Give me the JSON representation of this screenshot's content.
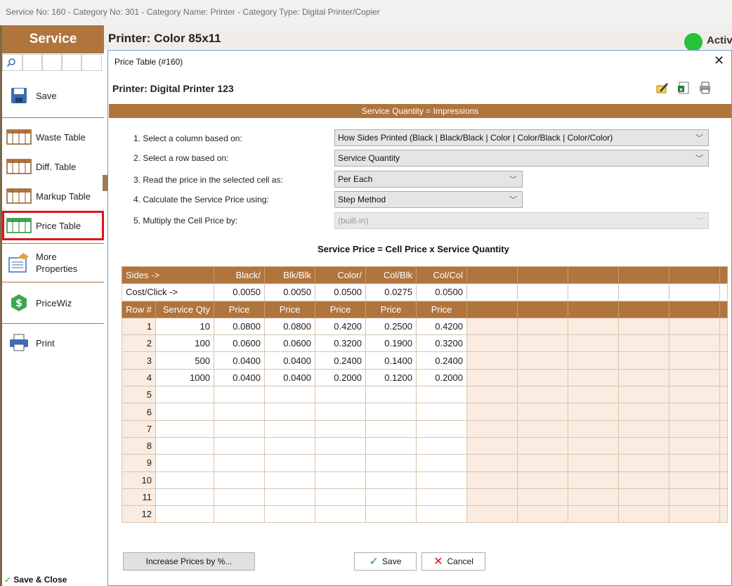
{
  "window": {
    "title": "Service No: 160  -  Category No: 301  -  Category Name: Printer  -  Category Type: Digital Printer/Copier"
  },
  "sidebar": {
    "header": "Service",
    "items": [
      {
        "label": "Save",
        "icon": "save-icon"
      },
      {
        "label": "Waste Table",
        "icon": "table-icon"
      },
      {
        "label": "Diff. Table",
        "icon": "table-icon"
      },
      {
        "label": "Markup Table",
        "icon": "table-icon"
      },
      {
        "label": "Price Table",
        "icon": "table-icon",
        "highlighted": true
      },
      {
        "label": "More Properties",
        "icon": "properties-icon"
      },
      {
        "label": "PriceWiz",
        "icon": "dollar-icon"
      },
      {
        "label": "Print",
        "icon": "printer-icon"
      }
    ],
    "save_close": "Save & Close"
  },
  "main": {
    "title": "Printer: Color 85x11",
    "status": "Activ",
    "status_color": "#26c23a"
  },
  "dialog": {
    "title": "Price Table (#160)",
    "subtitle": "Printer: Digital Printer 123",
    "band": "Service Quantity = Impressions",
    "options": [
      {
        "label": "1. Select a column based on:",
        "value": "How Sides Printed  (Black  |  Black/Black  |  Color  |  Color/Black  |  Color/Color)"
      },
      {
        "label": "2. Select a row based on:",
        "value": "Service Quantity"
      },
      {
        "label": "3. Read the price in the selected cell as:",
        "value": "Per Each"
      },
      {
        "label": "4. Calculate the Service Price using:",
        "value": "Step Method"
      },
      {
        "label": "5. Multiply the Cell Price by:",
        "value": "(built-in)",
        "disabled": true
      }
    ],
    "formula": "Service Price = Cell Price x Service Quantity",
    "table": {
      "sides_label": "Sides ->",
      "sides": [
        "Black/",
        "Blk/Blk",
        "Color/",
        "Col/Blk",
        "Col/Col"
      ],
      "cost_label": "Cost/Click ->",
      "cost": [
        "0.0050",
        "0.0050",
        "0.0500",
        "0.0275",
        "0.0500"
      ],
      "col_row": "Row #",
      "col_qty": "Service Qty",
      "price_label": "Price",
      "rows": [
        {
          "n": "1",
          "qty": "10",
          "p": [
            "0.0800",
            "0.0800",
            "0.4200",
            "0.2500",
            "0.4200"
          ]
        },
        {
          "n": "2",
          "qty": "100",
          "p": [
            "0.0600",
            "0.0600",
            "0.3200",
            "0.1900",
            "0.3200"
          ]
        },
        {
          "n": "3",
          "qty": "500",
          "p": [
            "0.0400",
            "0.0400",
            "0.2400",
            "0.1400",
            "0.2400"
          ]
        },
        {
          "n": "4",
          "qty": "1000",
          "p": [
            "0.0400",
            "0.0400",
            "0.2000",
            "0.1200",
            "0.2000"
          ]
        },
        {
          "n": "5",
          "qty": "",
          "p": [
            "",
            "",
            "",
            "",
            ""
          ]
        },
        {
          "n": "6",
          "qty": "",
          "p": [
            "",
            "",
            "",
            "",
            ""
          ]
        },
        {
          "n": "7",
          "qty": "",
          "p": [
            "",
            "",
            "",
            "",
            ""
          ]
        },
        {
          "n": "8",
          "qty": "",
          "p": [
            "",
            "",
            "",
            "",
            ""
          ]
        },
        {
          "n": "9",
          "qty": "",
          "p": [
            "",
            "",
            "",
            "",
            ""
          ]
        },
        {
          "n": "10",
          "qty": "",
          "p": [
            "",
            "",
            "",
            "",
            ""
          ]
        },
        {
          "n": "11",
          "qty": "",
          "p": [
            "",
            "",
            "",
            "",
            ""
          ]
        },
        {
          "n": "12",
          "qty": "",
          "p": [
            "",
            "",
            "",
            "",
            ""
          ]
        }
      ]
    },
    "buttons": {
      "increase": "Increase Prices by %...",
      "save": "Save",
      "cancel": "Cancel"
    }
  },
  "colors": {
    "accent": "#b0743d",
    "cell_pink": "#fbece1",
    "highlight": "#e0141a"
  }
}
